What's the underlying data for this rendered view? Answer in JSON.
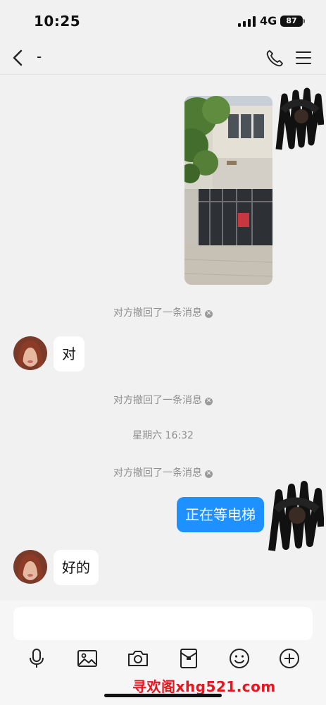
{
  "status_bar": {
    "time": "10:25",
    "network": "4G",
    "battery": "87"
  },
  "nav": {
    "title": "-",
    "back_icon": "chevron-left-icon",
    "call_icon": "phone-icon",
    "menu_icon": "hamburger-menu-icon"
  },
  "chat": {
    "retracted_notice_1": "对方撤回了一条消息",
    "message_1": "对",
    "retracted_notice_2": "对方撤回了一条消息",
    "timestamp": "星期六 16:32",
    "retracted_notice_3": "对方撤回了一条消息",
    "message_2": "正在等电梯",
    "message_3": "好的"
  },
  "input": {
    "placeholder": "",
    "toolbar": [
      "mic-icon",
      "image-icon",
      "camera-icon",
      "red-packet-icon",
      "emoji-icon",
      "plus-icon"
    ]
  },
  "watermark": "寻欢阁xhg521.com",
  "colors": {
    "outgoing_bubble": "#1e90ff",
    "incoming_bubble": "#ffffff",
    "background": "#f1f1f1",
    "watermark": "#e8141e"
  }
}
